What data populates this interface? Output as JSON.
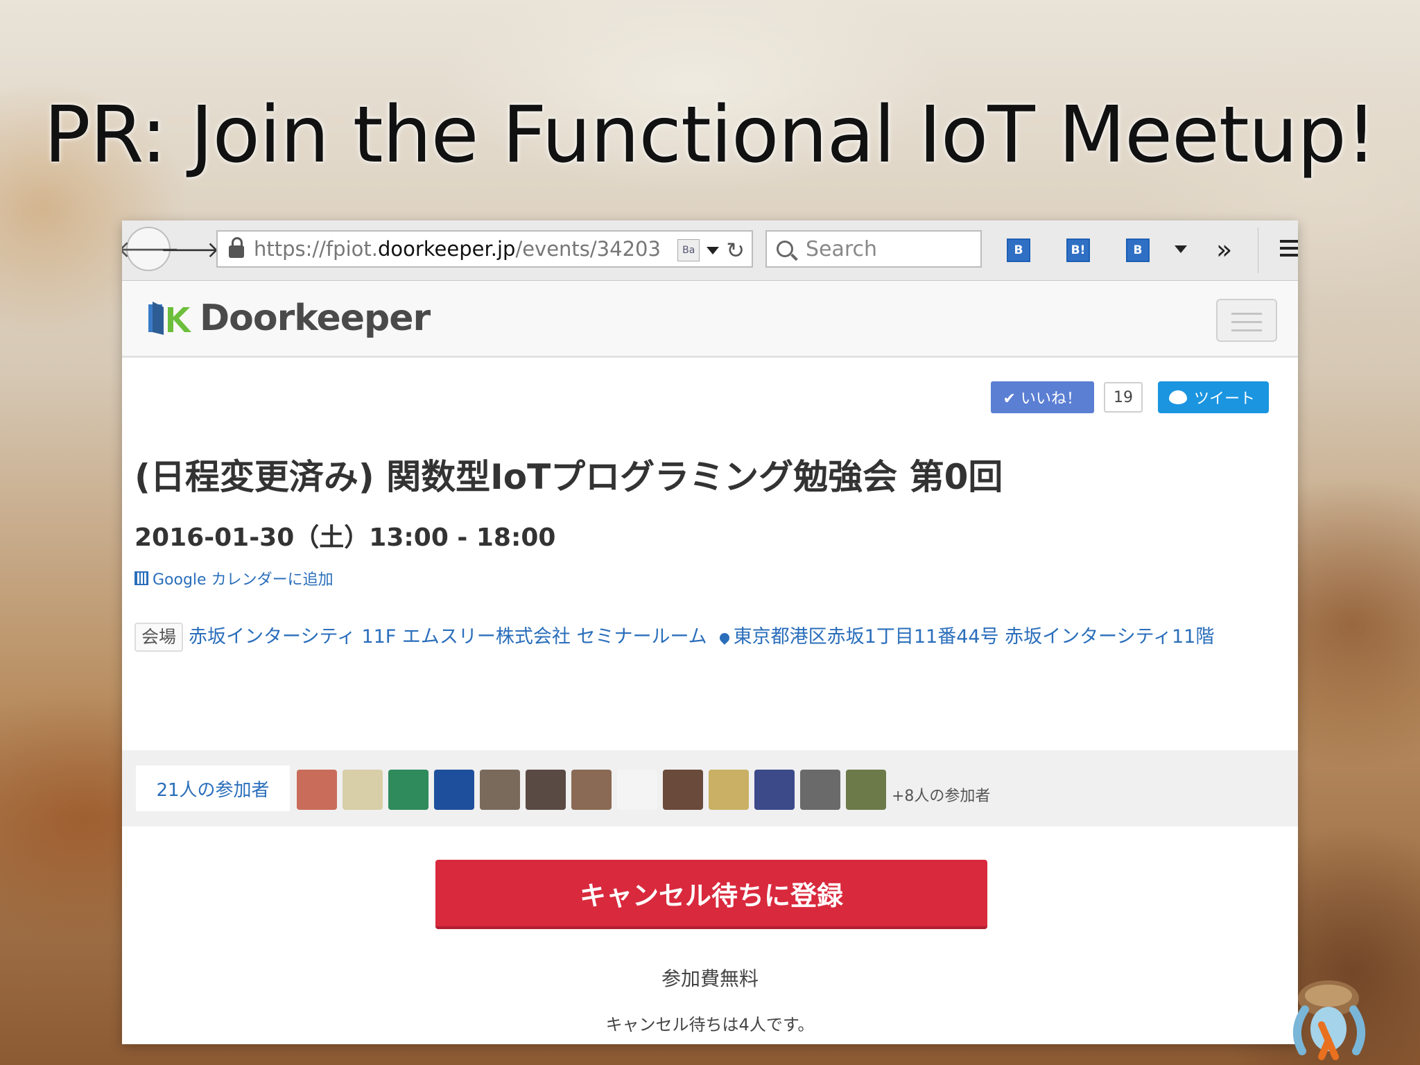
{
  "slide": {
    "title": "PR: Join the Functional IoT Meetup!"
  },
  "browser": {
    "back_icon": "arrow-left-icon",
    "forward_icon": "arrow-right-icon",
    "url_scheme": "https://fpiot.",
    "url_host": "doorkeeper.jp",
    "url_path": "/events/34203",
    "search_placeholder": "Search",
    "toolbar_icons": [
      "hatena-bookmark-list-icon",
      "hatena-bookmark-icon",
      "hatena-bookmark-add-icon"
    ],
    "toolbar_icon_labels": [
      "B",
      "B!",
      "B"
    ]
  },
  "site": {
    "logo_text": "Doorkeeper"
  },
  "social": {
    "like_label": "✔ いいね！",
    "like_count": "19",
    "tweet_label": "ツイート"
  },
  "event": {
    "title": "(日程変更済み) 関数型IoTプログラミング勉強会 第0回",
    "date": "2016-01-30（土）13:00 - 18:00",
    "gcal_label": "Google カレンダーに追加",
    "venue_label": "会場",
    "venue_name": "赤坂インターシティ 11F エムスリー株式会社 セミナールーム",
    "venue_address": "東京都港区赤坂1丁目11番44号 赤坂インターシティ11階"
  },
  "attendees": {
    "count_label": "21人の参加者",
    "more_label": "+8人の参加者",
    "avatar_colors": [
      "#c96d5a",
      "#d8cfa8",
      "#2f8a5c",
      "#1e4f9c",
      "#7a6a5c",
      "#5a4a44",
      "#8a6a54",
      "#f4f4f4",
      "#6a4a3a",
      "#c9b064",
      "#3c4a8a",
      "#6a6a6a",
      "#6c7a4a"
    ]
  },
  "registration": {
    "button_label": "キャンセル待ちに登録",
    "fee_text": "参加費無料",
    "waitlist_text": "キャンセル待ちは4人です。"
  },
  "colors": {
    "cta": "#d9293d",
    "link": "#2a6ebb",
    "like": "#5b7fd3",
    "tweet": "#1b95e0"
  }
}
